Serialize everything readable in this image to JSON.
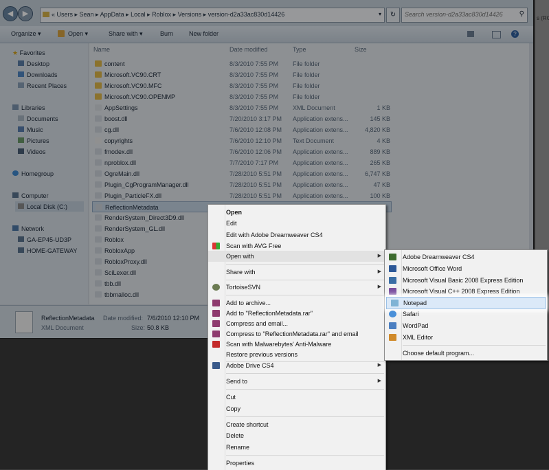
{
  "address": {
    "path": "« Users ▸ Sean ▸ AppData ▸ Local ▸ Roblox ▸ Versions ▸ version-d2a33ac830d14426",
    "search_placeholder": "Search version-d2a33ac830d14426",
    "right_edge_fragment": "s (RG"
  },
  "toolbar": {
    "organize": "Organize ▾",
    "open": "Open ▾",
    "share": "Share with ▾",
    "burn": "Burn",
    "new_folder": "New folder"
  },
  "nav": {
    "favorites": "Favorites",
    "desktop": "Desktop",
    "downloads": "Downloads",
    "recent": "Recent Places",
    "libraries": "Libraries",
    "documents": "Documents",
    "music": "Music",
    "pictures": "Pictures",
    "videos": "Videos",
    "homegroup": "Homegroup",
    "computer": "Computer",
    "local_disk": "Local Disk (C:)",
    "network": "Network",
    "ga": "GA-EP45-UD3P",
    "home_gateway": "HOME-GATEWAY"
  },
  "columns": {
    "name": "Name",
    "date": "Date modified",
    "type": "Type",
    "size": "Size"
  },
  "files": [
    {
      "name": "content",
      "date": "8/3/2010 7:55 PM",
      "type": "File folder",
      "size": ""
    },
    {
      "name": "Microsoft.VC90.CRT",
      "date": "8/3/2010 7:55 PM",
      "type": "File folder",
      "size": ""
    },
    {
      "name": "Microsoft.VC90.MFC",
      "date": "8/3/2010 7:55 PM",
      "type": "File folder",
      "size": ""
    },
    {
      "name": "Microsoft.VC90.OPENMP",
      "date": "8/3/2010 7:55 PM",
      "type": "File folder",
      "size": ""
    },
    {
      "name": "AppSettings",
      "date": "8/3/2010 7:55 PM",
      "type": "XML Document",
      "size": "1 KB"
    },
    {
      "name": "boost.dll",
      "date": "7/20/2010 3:17 PM",
      "type": "Application extens...",
      "size": "145 KB"
    },
    {
      "name": "cg.dll",
      "date": "7/6/2010 12:08 PM",
      "type": "Application extens...",
      "size": "4,820 KB"
    },
    {
      "name": "copyrights",
      "date": "7/6/2010 12:10 PM",
      "type": "Text Document",
      "size": "4 KB"
    },
    {
      "name": "fmodex.dll",
      "date": "7/6/2010 12:06 PM",
      "type": "Application extens...",
      "size": "889 KB"
    },
    {
      "name": "nproblox.dll",
      "date": "7/7/2010 7:17 PM",
      "type": "Application extens...",
      "size": "265 KB"
    },
    {
      "name": "OgreMain.dll",
      "date": "7/28/2010 5:51 PM",
      "type": "Application extens...",
      "size": "6,747 KB"
    },
    {
      "name": "Plugin_CgProgramManager.dll",
      "date": "7/28/2010 5:51 PM",
      "type": "Application extens...",
      "size": "47 KB"
    },
    {
      "name": "Plugin_ParticleFX.dll",
      "date": "7/28/2010 5:51 PM",
      "type": "Application extens...",
      "size": "100 KB"
    },
    {
      "name": "ReflectionMetadata",
      "date": "",
      "type": "",
      "size": ""
    },
    {
      "name": "RenderSystem_Direct3D9.dll",
      "date": "",
      "type": "",
      "size": ""
    },
    {
      "name": "RenderSystem_GL.dll",
      "date": "",
      "type": "",
      "size": ""
    },
    {
      "name": "Roblox",
      "date": "",
      "type": "",
      "size": ""
    },
    {
      "name": "RobloxApp",
      "date": "",
      "type": "",
      "size": ""
    },
    {
      "name": "RobloxProxy.dll",
      "date": "",
      "type": "",
      "size": ""
    },
    {
      "name": "SciLexer.dll",
      "date": "",
      "type": "",
      "size": ""
    },
    {
      "name": "tbb.dll",
      "date": "",
      "type": "",
      "size": ""
    },
    {
      "name": "tbbmalloc.dll",
      "date": "",
      "type": "",
      "size": ""
    }
  ],
  "details": {
    "name": "ReflectionMetadata",
    "type": "XML Document",
    "date_label": "Date modified:",
    "date_value": "7/6/2010 12:10 PM",
    "size_label": "Size:",
    "size_value": "50.8 KB"
  },
  "context_menu": {
    "open": "Open",
    "edit": "Edit",
    "edit_dw": "Edit with Adobe Dreamweaver CS4",
    "scan_avg": "Scan with AVG Free",
    "open_with": "Open with",
    "share_with": "Share with",
    "tortoise": "TortoiseSVN",
    "add_archive": "Add to archive...",
    "add_rar": "Add to \"ReflectionMetadata.rar\"",
    "compress_email": "Compress and email...",
    "compress_rar_email": "Compress to \"ReflectionMetadata.rar\" and email",
    "scan_mb": "Scan with Malwarebytes' Anti-Malware",
    "restore": "Restore previous versions",
    "adobe_drive": "Adobe Drive CS4",
    "send_to": "Send to",
    "cut": "Cut",
    "copy": "Copy",
    "create_shortcut": "Create shortcut",
    "delete": "Delete",
    "rename": "Rename",
    "properties": "Properties"
  },
  "open_with_menu": {
    "dreamweaver": "Adobe Dreamweaver CS4",
    "word": "Microsoft Office Word",
    "vb": "Microsoft Visual Basic 2008 Express Edition",
    "vc": "Microsoft Visual C++ 2008 Express Edition",
    "notepad": "Notepad",
    "safari": "Safari",
    "wordpad": "WordPad",
    "xml_editor": "XML Editor",
    "choose": "Choose default program..."
  }
}
